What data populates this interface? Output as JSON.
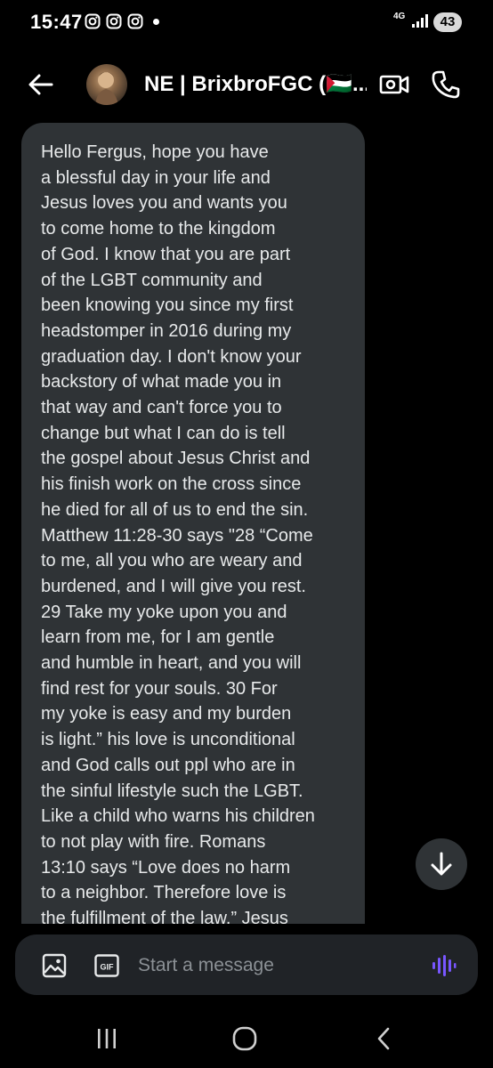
{
  "status_bar": {
    "time": "15:47",
    "network_label": "4G",
    "battery": "43",
    "notification_icons": [
      "instagram-icon",
      "instagram-icon",
      "instagram-icon"
    ]
  },
  "header": {
    "contact_name": "NE | BrixbroFGC (🇵🇸...",
    "back_icon": "arrow-left-icon",
    "video_icon": "video-call-icon",
    "phone_icon": "phone-icon"
  },
  "message": {
    "lines": [
      "Hello Fergus, hope you have",
      "a blessful day in your life and",
      "Jesus loves you and wants you",
      "to come home to the kingdom",
      "of God. I know that you are part",
      "of the LGBT community and",
      "been knowing you since my first",
      "headstomper in 2016 during my",
      "graduation day. I don't know your",
      "backstory of what made you in",
      "that way and can't force you to",
      "change but what I can do is tell",
      "the gospel about Jesus Christ and",
      "his finish work on the cross since",
      "he died for all of us to end the sin.",
      "Matthew 11:28-30 says \"28 “Come",
      "to me, all you who are weary and",
      "burdened, and I will give you rest.",
      "29 Take my yoke upon you and",
      "learn from me, for I am gentle",
      "and humble in heart, and you will",
      "find rest for your souls. 30 For",
      "my yoke is easy and my burden",
      "is light.” his love is unconditional",
      "and God calls out ppl who are in",
      "the sinful lifestyle such the LGBT.",
      "Like a child who warns his children",
      "to not play with fire. Romans",
      "13:10 says “Love does no harm",
      "to a neighbor. Therefore love is",
      "the fulfillment of the law.” Jesus"
    ]
  },
  "composer": {
    "placeholder": "Start a message",
    "gif_label": "GIF"
  },
  "colors": {
    "background": "#000000",
    "bubble": "#2f3336",
    "composer": "#202327",
    "accent": "#7856ff",
    "text": "#e7e9ea"
  }
}
